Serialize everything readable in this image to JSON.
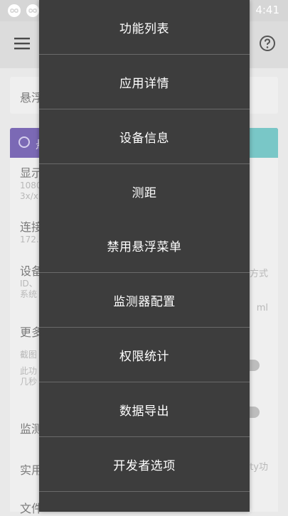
{
  "status_bar": {
    "time": "4:41",
    "left_icons": [
      "infinity-icon",
      "infinity-icon"
    ],
    "right_icons": [
      "wifi-icon",
      "no-sim-icon",
      "battery-icon"
    ]
  },
  "app_bar": {
    "left_icon": "hamburger-menu-icon",
    "right_icon": "help-circle-icon"
  },
  "background": {
    "card1_text": "悬浮",
    "banner_text": "悬",
    "rows": [
      {
        "title": "显示",
        "sub": "1080",
        "sub2": "3x/x"
      },
      {
        "title": "连接",
        "sub": "172."
      },
      {
        "title": "设备",
        "sub": "ID、",
        "sub2": "系统",
        "right": "方式",
        "right2": "ml"
      },
      {
        "title": "更多",
        "sub": "截图",
        "sub2": "此功",
        "sub3": "几秒"
      },
      {
        "title": "监测"
      },
      {
        "title": "实用",
        "right": "ity功"
      },
      {
        "title": "文件"
      }
    ]
  },
  "menu": {
    "items": [
      {
        "label": "功能列表"
      },
      {
        "label": "应用详情"
      },
      {
        "label": "设备信息"
      },
      {
        "label": "测距"
      },
      {
        "label": "禁用悬浮菜单"
      },
      {
        "label": "监测器配置"
      },
      {
        "label": "权限统计"
      },
      {
        "label": "数据导出"
      },
      {
        "label": "开发者选项"
      }
    ]
  }
}
